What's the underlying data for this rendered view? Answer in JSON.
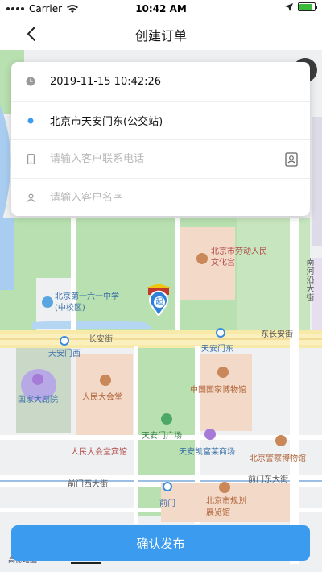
{
  "status_bar": {
    "carrier": "Carrier",
    "time": "10:42 AM",
    "battery_level": 0.9
  },
  "nav": {
    "title": "创建订单"
  },
  "form": {
    "datetime": "2019-11-15 10:42:26",
    "location": "北京市天安门东(公交站)",
    "phone_placeholder": "请输入客户联系电话",
    "name_placeholder": "请输入客户名字"
  },
  "map": {
    "labels": {
      "labor_palace": "北京市劳动人民文化宫",
      "school": "北京第一六一中学(中校区)",
      "chang_an": "长安街",
      "dong_chang_an": "东长安街",
      "tam_west": "天安门西",
      "tam_east": "天安门东",
      "theatre": "国家大剧院",
      "great_hall": "人民大会堂",
      "museum": "中国国家博物馆",
      "square": "天安门广场",
      "hotel": "人民大会堂宾馆",
      "kempinski": "天安凯富莱商场",
      "police_museum": "北京警察博物馆",
      "qianmen_west": "前门西大街",
      "qianmen_east": "前门东大街",
      "qianmen": "前门",
      "planning_hall": "北京市规划展览馆",
      "nanheyan": "南河沿大街"
    },
    "pin_label": "起",
    "amap_logo": "高德地图",
    "scale": "200m"
  },
  "confirm": {
    "label": "确认发布"
  },
  "colors": {
    "accent": "#3a9bef",
    "map_green": "#b8e0b0",
    "map_water": "#a9cdf0"
  }
}
